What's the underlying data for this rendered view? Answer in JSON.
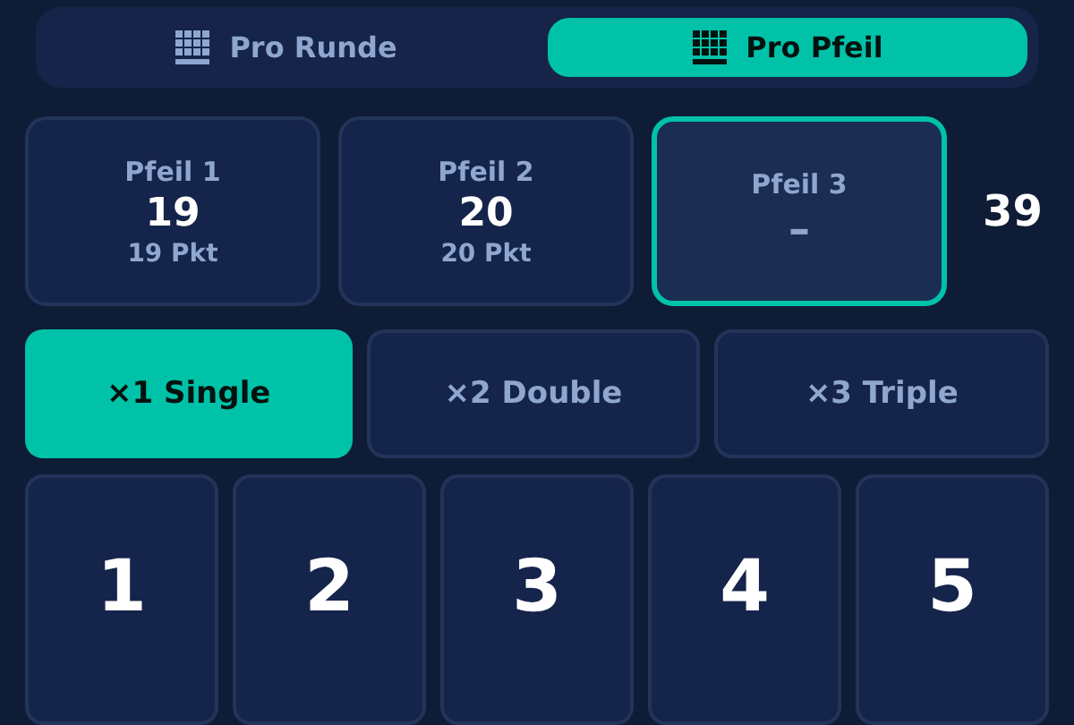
{
  "mode_tabs": [
    {
      "label": "Pro Runde",
      "selected": false
    },
    {
      "label": "Pro Pfeil",
      "selected": true
    }
  ],
  "darts": [
    {
      "label": "Pfeil 1",
      "value": "19",
      "points": "19 Pkt",
      "selected": false
    },
    {
      "label": "Pfeil 2",
      "value": "20",
      "points": "20 Pkt",
      "selected": false
    },
    {
      "label": "Pfeil 3",
      "value": "–",
      "selected": true
    }
  ],
  "total": "39",
  "multipliers": [
    {
      "label": "×1 Single",
      "selected": true
    },
    {
      "label": "×2 Double",
      "selected": false
    },
    {
      "label": "×3 Triple",
      "selected": false
    }
  ],
  "number_keys": [
    "1",
    "2",
    "3",
    "4",
    "5"
  ]
}
